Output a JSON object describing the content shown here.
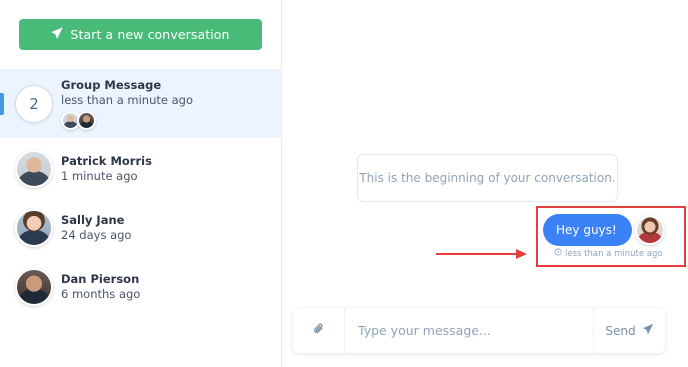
{
  "sidebar": {
    "new_conversation_label": "Start a new conversation",
    "conversations": [
      {
        "name": "Group Message",
        "time": "less than a minute ago",
        "count": "2",
        "active": true
      },
      {
        "name": "Patrick Morris",
        "time": "1 minute ago"
      },
      {
        "name": "Sally Jane",
        "time": "24 days ago"
      },
      {
        "name": "Dan Pierson",
        "time": "6 months ago"
      }
    ]
  },
  "chat": {
    "beginning_text": "This is the beginning of your conversation.",
    "messages": [
      {
        "text": "Hey guys!",
        "time": "less than a minute ago"
      }
    ]
  },
  "composer": {
    "placeholder": "Type your message...",
    "send_label": "Send"
  },
  "colors": {
    "primary_green": "#48bb78",
    "message_blue": "#3b82f6",
    "active_bg": "#ebf4ff",
    "highlight_red": "#e53e3e"
  },
  "icons": [
    "paper-plane-icon",
    "paperclip-icon",
    "clock-icon",
    "send-icon"
  ]
}
